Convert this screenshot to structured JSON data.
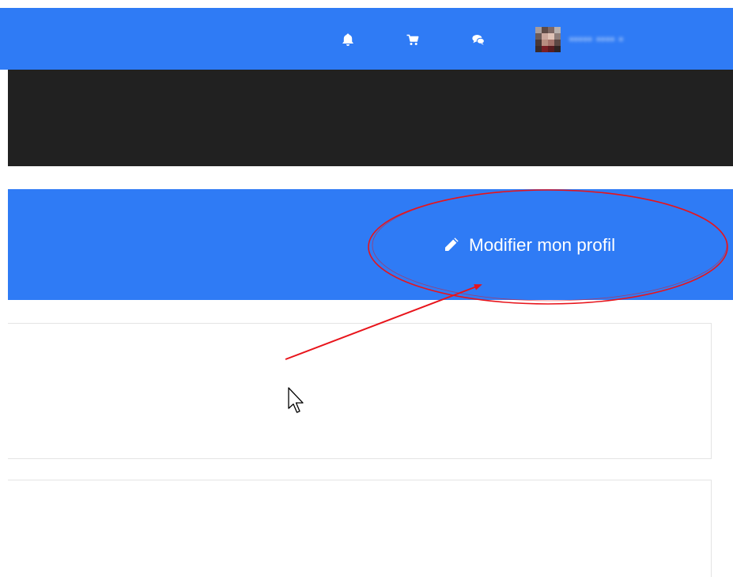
{
  "topbar": {
    "background": "#2f7bf5",
    "icons": [
      "bell-icon",
      "cart-icon",
      "chat-icon"
    ],
    "user": {
      "name": "••••• •••• •",
      "avatar": "avatar-pixelated"
    }
  },
  "header": {
    "background": "#212121"
  },
  "profile": {
    "background": "#2f7bf5",
    "edit_button": {
      "label": "Modifier mon profil",
      "icon": "pencil-icon"
    }
  },
  "annotation": {
    "color": "#e8141b",
    "shapes": [
      "ellipse",
      "arrow"
    ]
  }
}
